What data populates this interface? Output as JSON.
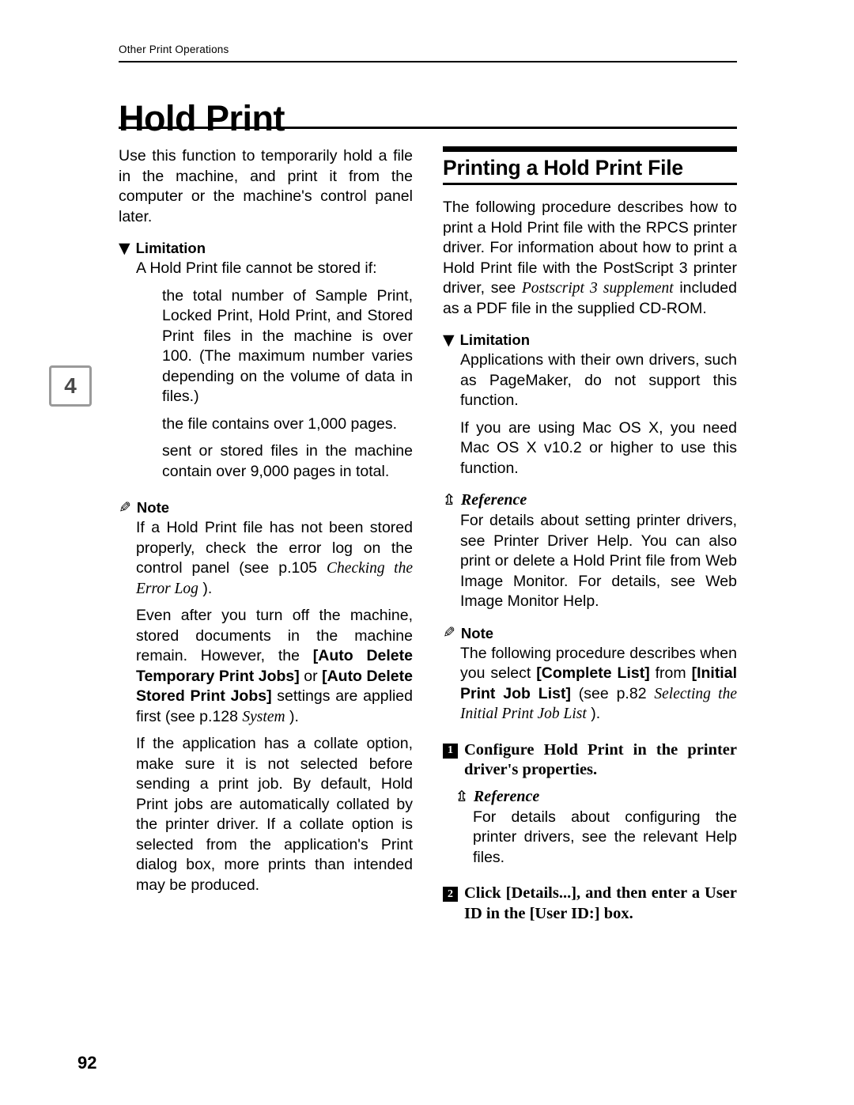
{
  "page": {
    "running_header": "Other Print Operations",
    "chapter_title": "Hold Print",
    "chapter_tab": "4",
    "folio": "92"
  },
  "left_column": {
    "intro": "Use this function to temporarily hold a file in the machine, and print it from the computer or the machine's control panel later.",
    "limitation_label": "Limitation",
    "limitation_intro": "A Hold Print file cannot be stored if:",
    "limitation_items": [
      "the total number of Sample Print, Locked Print, Hold Print, and Stored Print files in the machine is over 100. (The maximum number varies depending on the volume of data in files.)",
      "the file contains over 1,000 pages.",
      "sent or stored files in the machine contain over 9,000 pages in total."
    ],
    "note_label": "Note",
    "note_items": [
      {
        "pre": "If a Hold Print file has not been stored properly, check the error log on the control panel (see p.105 ",
        "italic": "Checking the Error Log",
        "post": " )."
      },
      {
        "pre": "Even after you turn off the machine, stored documents in the machine remain. However, the ",
        "bold1": "[Auto Delete Temporary Print Jobs]",
        "mid": " or ",
        "bold2": "[Auto Delete Stored Print Jobs]",
        "post": " settings are applied first (see p.128 ",
        "italic": "System",
        "tail": " )."
      },
      {
        "text": "If the application has a collate option, make sure it is not selected before sending a print job. By default, Hold Print jobs are automatically collated by the printer driver. If a collate option is selected from the application's Print dialog box, more prints than intended may be produced."
      }
    ]
  },
  "right_column": {
    "section_title": "Printing a Hold Print File",
    "section_intro": {
      "pre": "The following procedure describes how to print a Hold Print file with the RPCS printer driver. For information about how to print a Hold Print file with the PostScript 3 printer driver, see ",
      "italic": "Postscript 3 supplement",
      "post": " included as a PDF file in the supplied CD-ROM."
    },
    "limitation_label": "Limitation",
    "limitation_items": [
      "Applications with their own drivers, such as PageMaker, do not support this function.",
      "If you are using Mac OS X, you need Mac OS X v10.2 or higher to use this function."
    ],
    "reference_label": "Reference",
    "reference_text": "For details about setting printer drivers, see Printer Driver Help. You can also print or delete a Hold Print file from Web Image Monitor. For details, see Web Image Monitor Help.",
    "note_label": "Note",
    "note_item": {
      "pre": "The following procedure describes when you select ",
      "bold1": "[Complete List]",
      "mid": " from ",
      "bold2": "[Initial Print Job List]",
      "post": " (see p.82 ",
      "italic": "Selecting the Initial Print Job List",
      "tail": " )."
    },
    "steps": [
      {
        "num": "1",
        "text": "Configure Hold Print in the printer driver's properties."
      },
      {
        "num": "2",
        "pre": "Click ",
        "bold1": "[Details...]",
        "mid": ", and then enter a User ID in the ",
        "bold2": "[User ID:]",
        "post": " box."
      }
    ],
    "step1_reference_label": "Reference",
    "step1_reference_text": "For details about configuring the printer drivers, see the relevant Help files."
  },
  "icons": {
    "limitation": "limitation-icon",
    "note": "note-icon",
    "reference": "reference-icon"
  }
}
